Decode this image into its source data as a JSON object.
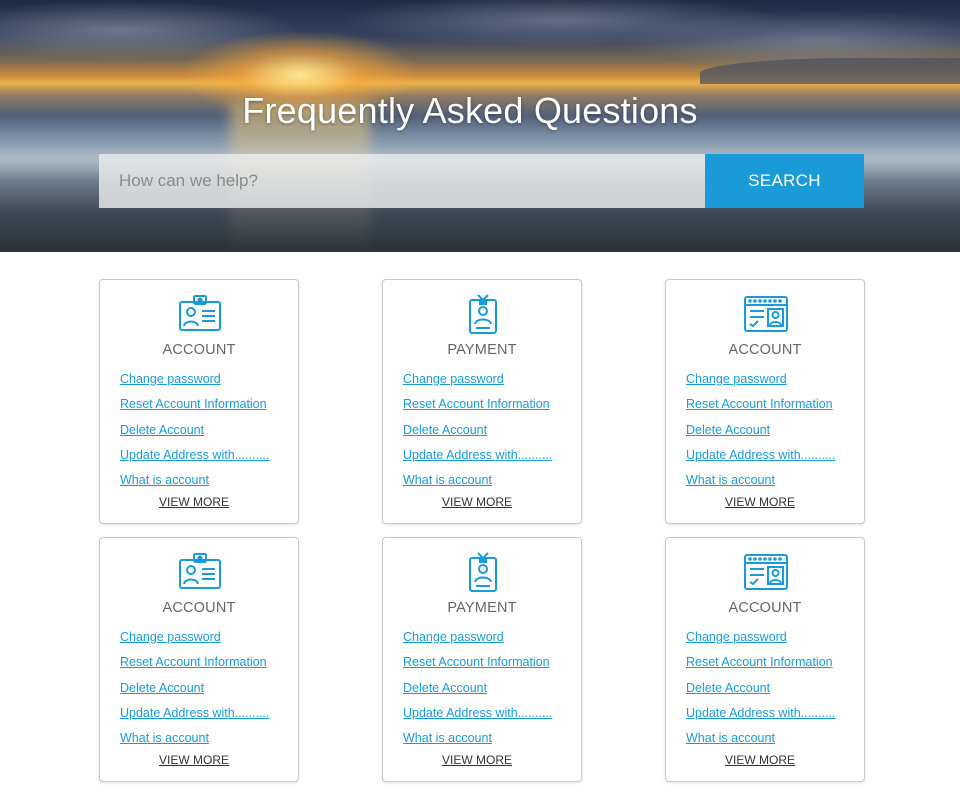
{
  "header": {
    "title": "Frequently Asked Questions",
    "search_placeholder": "How can we help?",
    "search_button": "SEARCH"
  },
  "theme": {
    "accent": "#1a9bd7",
    "title_gray": "#666666",
    "border": "#c9c9c9"
  },
  "cards": [
    {
      "icon": "id-card-icon",
      "title": "ACCOUNT",
      "links": [
        "Change password",
        "Reset Account Information",
        "Delete Account",
        "Update Address with..........",
        "What is account"
      ],
      "more": "VIEW MORE"
    },
    {
      "icon": "id-badge-icon",
      "title": "PAYMENT",
      "links": [
        "Change password",
        "Reset Account Information",
        "Delete Account",
        "Update Address with..........",
        "What is account"
      ],
      "more": "VIEW MORE"
    },
    {
      "icon": "browser-profile-icon",
      "title": "ACCOUNT",
      "links": [
        "Change password",
        "Reset Account Information",
        "Delete Account",
        "Update Address with..........",
        "What is account"
      ],
      "more": "VIEW MORE"
    },
    {
      "icon": "id-card-icon",
      "title": "ACCOUNT",
      "links": [
        "Change password",
        "Reset Account Information",
        "Delete Account",
        "Update Address with..........",
        "What is account"
      ],
      "more": "VIEW MORE"
    },
    {
      "icon": "id-badge-icon",
      "title": "PAYMENT",
      "links": [
        "Change password",
        "Reset Account Information",
        "Delete Account",
        "Update Address with..........",
        "What is account"
      ],
      "more": "VIEW MORE"
    },
    {
      "icon": "browser-profile-icon",
      "title": "ACCOUNT",
      "links": [
        "Change password",
        "Reset Account Information",
        "Delete Account",
        "Update Address with..........",
        "What is account"
      ],
      "more": "VIEW MORE"
    }
  ]
}
